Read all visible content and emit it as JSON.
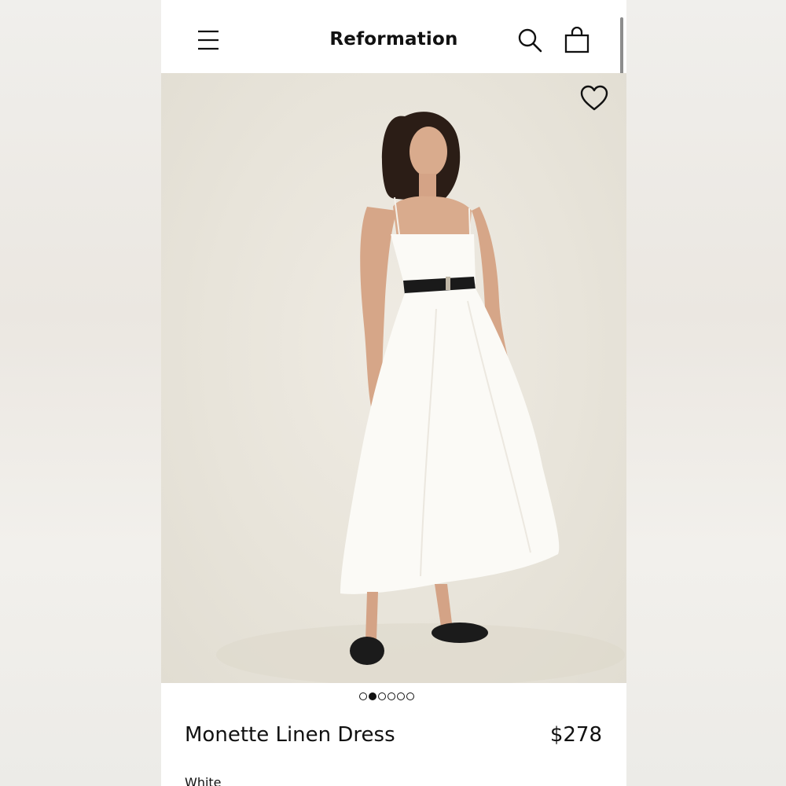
{
  "header": {
    "brand": "Reformation",
    "icons": [
      "menu-icon",
      "search-icon",
      "shopping-bag-icon"
    ]
  },
  "hero": {
    "favorite_icon": "heart-icon",
    "carousel": {
      "total": 6,
      "active_index": 1
    }
  },
  "product": {
    "name": "Monette Linen Dress",
    "price": "$278",
    "color": "White"
  }
}
